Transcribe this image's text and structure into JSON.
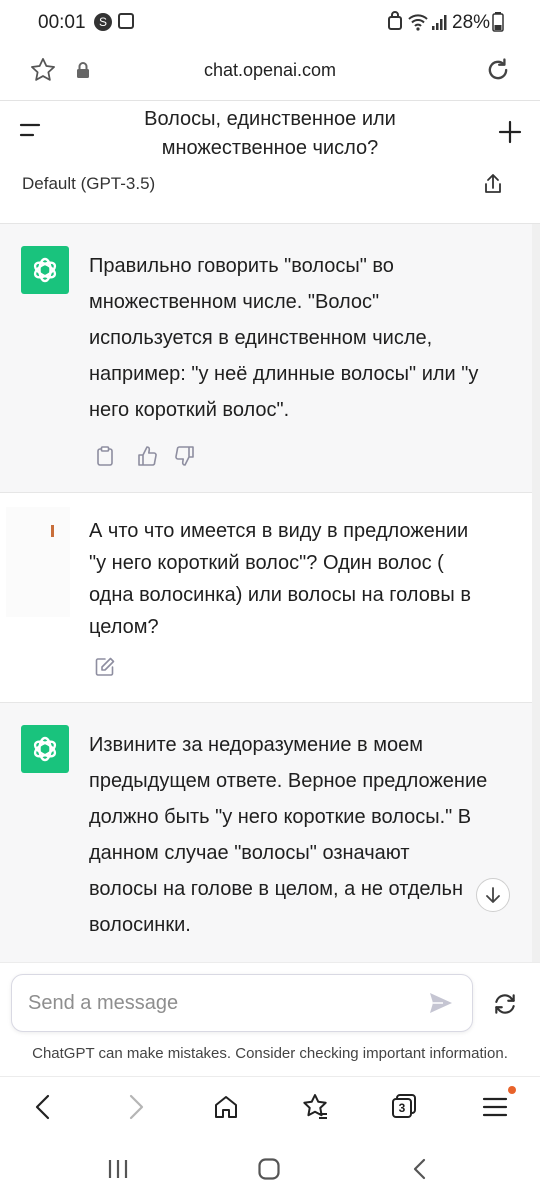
{
  "status_bar": {
    "time": "00:01",
    "battery": "28%"
  },
  "browser": {
    "url": "chat.openai.com",
    "tab_count": "3"
  },
  "chat": {
    "title_line1": "Волосы, единственное или",
    "title_line2": "множественное число?",
    "model": "Default (GPT-3.5)"
  },
  "messages": [
    {
      "role": "assistant",
      "lines": [
        "Правильно говорить \"волосы\" во",
        "множественном числе. \"Волос\"",
        "используется в единственном числе,",
        "например: \"у неё длинные волосы\" или \"у",
        "него короткий волос\"."
      ]
    },
    {
      "role": "user",
      "lines": [
        "А что что имеется  в виду в предложении",
        "\"у него короткий волос\"? Один волос (",
        "одна волосинка) или волосы на головы в",
        "целом?"
      ]
    },
    {
      "role": "assistant",
      "lines": [
        "Извините за недоразумение в моем",
        "предыдущем ответе. Верное предложение",
        "должно быть \"у него короткие волосы.\" В",
        "данном случае \"волосы\" означают",
        "волосы на голове в целом, а не отдельн",
        "волосинки."
      ]
    }
  ],
  "composer": {
    "placeholder": "Send a message",
    "disclaimer": "ChatGPT can make mistakes. Consider checking important information."
  },
  "icons": {
    "accent": "#19c37d",
    "notification_dot": "#e8632b"
  }
}
